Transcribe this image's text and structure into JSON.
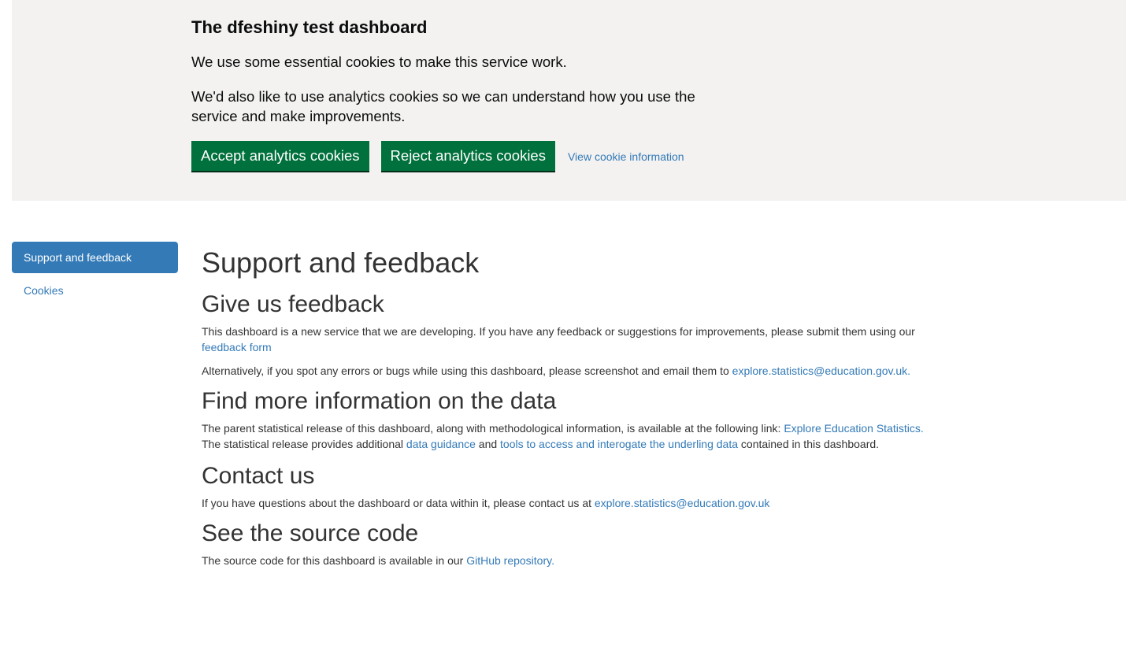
{
  "cookie_banner": {
    "title": "The dfeshiny test dashboard",
    "text_1": "We use some essential cookies to make this service work.",
    "text_2": "We'd also like to use analytics cookies so we can understand how you use the service and make improvements.",
    "accept_label": "Accept analytics cookies",
    "reject_label": "Reject analytics cookies",
    "view_link": "View cookie information"
  },
  "sidebar": {
    "items": [
      {
        "label": "Support and feedback",
        "active": true
      },
      {
        "label": "Cookies",
        "active": false
      }
    ]
  },
  "main": {
    "title": "Support and feedback",
    "feedback": {
      "heading": "Give us feedback",
      "p1_text": "This dashboard is a new service that we are developing. If you have any feedback or suggestions for improvements, please submit them using our ",
      "p1_link": "feedback form",
      "p2_text": "Alternatively, if you spot any errors or bugs while using this dashboard, please screenshot and email them to ",
      "p2_link": "explore.statistics@education.gov.uk",
      "p2_end": "."
    },
    "more_info": {
      "heading": "Find more information on the data",
      "p1_text": "The parent statistical release of this dashboard, along with methodological information, is available at the following link: ",
      "p1_link": "Explore Education Statistics",
      "p1_end": ".",
      "p2_text": "The statistical release provides additional ",
      "p2_link1": "data guidance",
      "p2_mid": " and ",
      "p2_link2": "tools to access and interogate the underling data",
      "p2_end": " contained in this dashboard."
    },
    "contact": {
      "heading": "Contact us",
      "p1_text": "If you have questions about the dashboard or data within it, please contact us at ",
      "p1_link": "explore.statistics@education.gov.uk"
    },
    "source": {
      "heading": "See the source code",
      "p1_text": "The source code for this dashboard is available in our ",
      "p1_link": "GitHub repository",
      "p1_end": "."
    }
  },
  "colors": {
    "banner_bg": "#f3f2f1",
    "button_green": "#00703c",
    "link_blue": "#337ab7",
    "active_nav": "#337ab7"
  }
}
